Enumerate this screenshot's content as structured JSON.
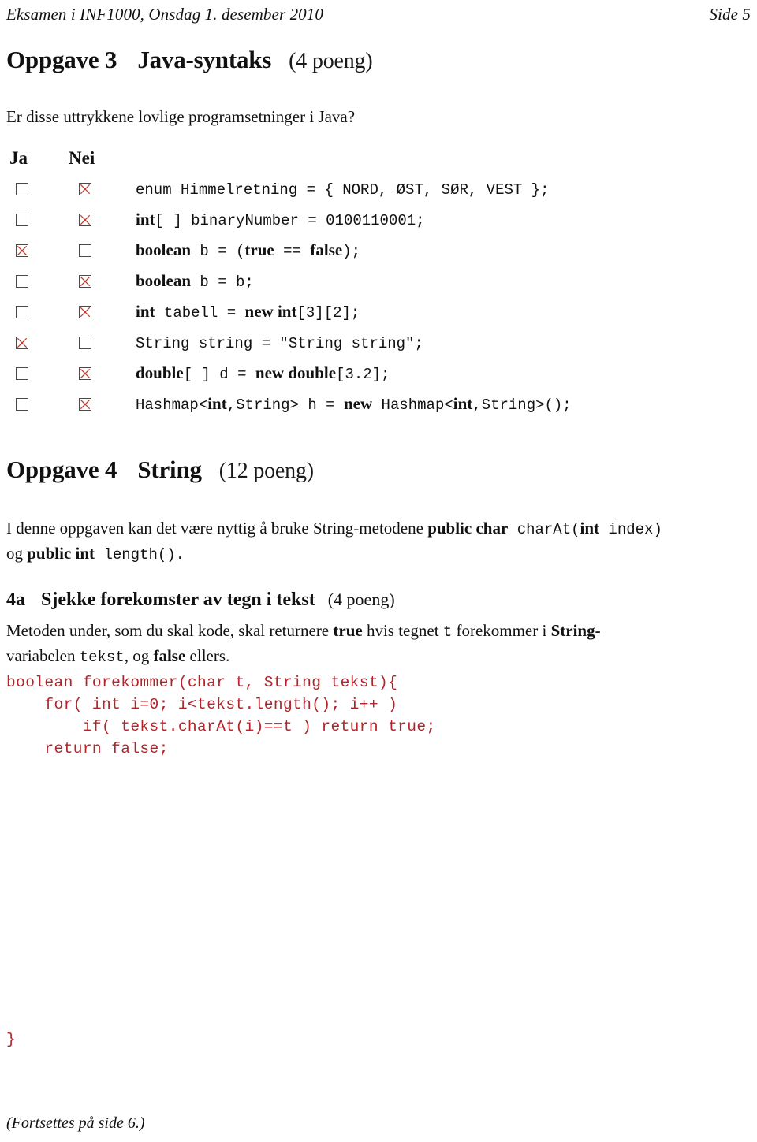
{
  "colors": {
    "text": "#111111",
    "code_red": "#b3232a",
    "checkbox_border": "#4a4a4a",
    "cross_red": "#c0392b"
  },
  "running_header": {
    "left": "Eksamen i INF1000, Onsdag 1. desember 2010",
    "right": "Side 5"
  },
  "section3": {
    "number": "Oppgave 3",
    "title": "Java-syntaks",
    "points": "(4 poeng)",
    "intro": "Er disse uttrykkene lovlige programsetninger i Java?",
    "col_ja": "Ja",
    "col_nei": "Nei",
    "rows": [
      {
        "answer": "nei",
        "ja_checked": false,
        "nei_checked": true,
        "parts": [
          {
            "t": "enum Himmelretning = { NORD, ØST, SØR, VEST };",
            "style": "mono"
          }
        ]
      },
      {
        "answer": "nei",
        "ja_checked": false,
        "nei_checked": true,
        "parts": [
          {
            "t": "int",
            "style": "keyword"
          },
          {
            "t": "[ ] binaryNumber = 0100110001;",
            "style": "mono"
          }
        ]
      },
      {
        "answer": "ja",
        "ja_checked": true,
        "nei_checked": false,
        "parts": [
          {
            "t": "boolean",
            "style": "keyword"
          },
          {
            "t": " b = (",
            "style": "mono"
          },
          {
            "t": "true",
            "style": "keyword"
          },
          {
            "t": " == ",
            "style": "mono"
          },
          {
            "t": "false",
            "style": "keyword"
          },
          {
            "t": ");",
            "style": "mono"
          }
        ]
      },
      {
        "answer": "nei",
        "ja_checked": false,
        "nei_checked": true,
        "parts": [
          {
            "t": "boolean",
            "style": "keyword"
          },
          {
            "t": " b = b;",
            "style": "mono"
          }
        ]
      },
      {
        "answer": "nei",
        "ja_checked": false,
        "nei_checked": true,
        "parts": [
          {
            "t": "int",
            "style": "keyword"
          },
          {
            "t": " tabell = ",
            "style": "mono"
          },
          {
            "t": "new int",
            "style": "keyword"
          },
          {
            "t": "[3][2];",
            "style": "mono"
          }
        ]
      },
      {
        "answer": "ja",
        "ja_checked": true,
        "nei_checked": false,
        "parts": [
          {
            "t": "String string = \"String string\";",
            "style": "mono"
          }
        ]
      },
      {
        "answer": "nei",
        "ja_checked": false,
        "nei_checked": true,
        "parts": [
          {
            "t": "double",
            "style": "keyword"
          },
          {
            "t": "[ ] d = ",
            "style": "mono"
          },
          {
            "t": "new double",
            "style": "keyword"
          },
          {
            "t": "[3.2];",
            "style": "mono"
          }
        ]
      },
      {
        "answer": "nei",
        "ja_checked": false,
        "nei_checked": true,
        "parts": [
          {
            "t": "Hashmap<",
            "style": "mono"
          },
          {
            "t": "int",
            "style": "keyword"
          },
          {
            "t": ",String> h = ",
            "style": "mono"
          },
          {
            "t": "new",
            "style": "keyword"
          },
          {
            "t": " Hashmap<",
            "style": "mono"
          },
          {
            "t": "int",
            "style": "keyword"
          },
          {
            "t": ",String>();",
            "style": "mono"
          }
        ]
      }
    ]
  },
  "section4": {
    "number": "Oppgave 4",
    "title": "String",
    "points": "(12 poeng)",
    "intro_line1_a": "I denne oppgaven kan det være nyttig å bruke String-metodene ",
    "intro_line1_b": "public char",
    "intro_line1_c": " charAt(",
    "intro_line1_d": "int",
    "intro_line1_e": " index)",
    "intro_line2_a": "og ",
    "intro_line2_b": "public int",
    "intro_line2_c": " length().",
    "sub": {
      "number": "4a",
      "title": "Sjekke forekomster av tegn i tekst",
      "points": "(4 poeng)",
      "body_a": "Metoden under, som du skal kode, skal returnere ",
      "body_b": "true",
      "body_c": " hvis tegnet ",
      "body_d": "t",
      "body_e": " forekommer i ",
      "body_f": "String-",
      "body_g": "variabelen ",
      "body_h": "tekst",
      "body_i": ", og ",
      "body_j": "false",
      "body_k": " ellers."
    },
    "code": "boolean forekommer(char t, String tekst){\n    for( int i=0; i<tekst.length(); i++ )\n        if( tekst.charAt(i)==t ) return true;\n    return false;",
    "code_close": "}"
  },
  "footer": "(Fortsettes på side 6.)"
}
